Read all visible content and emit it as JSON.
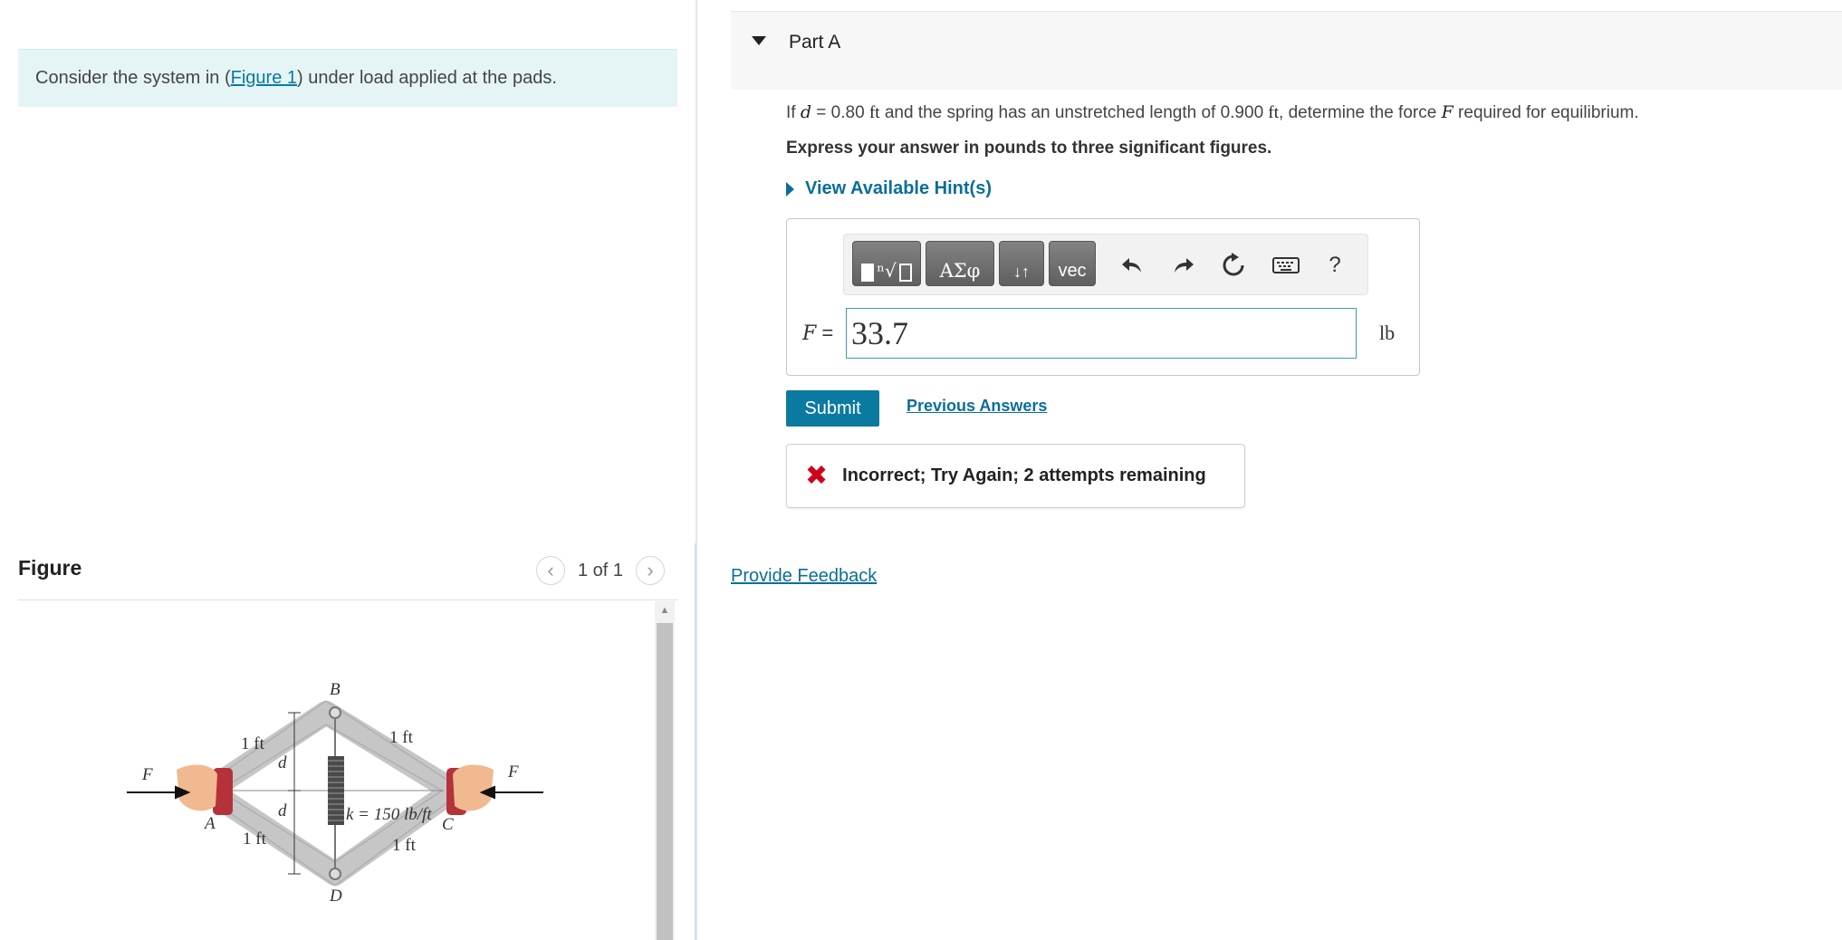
{
  "problem": {
    "text_before": "Consider the system in (",
    "figure_link": "Figure 1",
    "text_after": ") under load applied at the pads."
  },
  "figure_panel": {
    "heading": "Figure",
    "count": "1 of 1",
    "prev_icon": "chevron-left-icon",
    "next_icon": "chevron-right-icon",
    "labels": {
      "B": "B",
      "D": "D",
      "A": "A",
      "C": "C",
      "F": "F",
      "d": "d",
      "one_ft": "1 ft",
      "spring": "k = 150 lb/ft"
    }
  },
  "part": {
    "title": "Part A",
    "question": {
      "t1": "If ",
      "var_d": "d",
      "t2": " = 0.80 ",
      "unit_ft": "ft",
      "t3": " and the spring has an unstretched length of 0.900 ",
      "t4": ", determine the force ",
      "var_F": "F",
      "t5": " required for equilibrium."
    },
    "instruction": "Express your answer in pounds to three significant figures.",
    "hint_label": "View Available Hint(s)",
    "toolbar": {
      "templates_icon": "templates-icon",
      "greek_label": "ΑΣφ",
      "arrows_label": "↓↑",
      "vec_label": "vec",
      "undo_icon": "undo-icon",
      "redo_icon": "redo-icon",
      "reset_icon": "reset-icon",
      "keyboard_icon": "keyboard-icon",
      "help_label": "?"
    },
    "answer": {
      "variable": "F",
      "equals": " =",
      "value": "33.7",
      "unit": "lb"
    },
    "submit_label": "Submit",
    "previous_answers_label": "Previous Answers",
    "feedback": {
      "icon": "✖",
      "text": "Incorrect; Try Again; 2 attempts remaining",
      "color": "#d0021b"
    }
  },
  "provide_feedback_label": "Provide Feedback",
  "colors": {
    "link": "#0b6e99",
    "submit": "#0b7aa0",
    "problem_bg": "#e5f5f6"
  }
}
